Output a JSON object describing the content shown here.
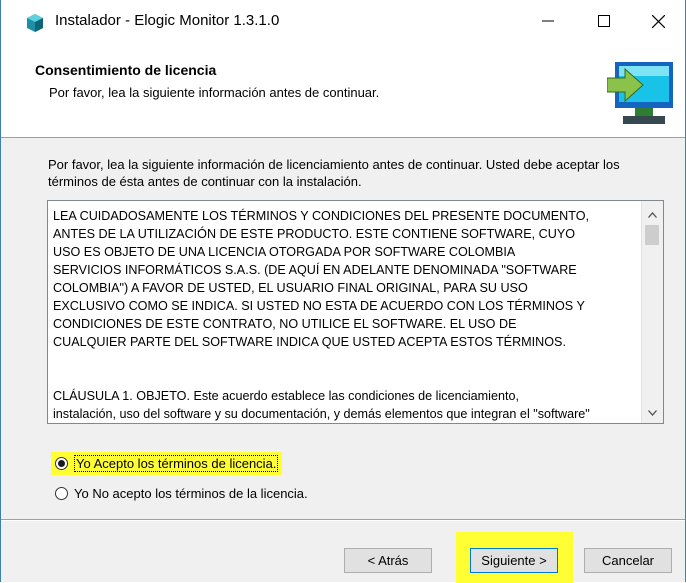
{
  "window": {
    "title": "Instalador - Elogic Monitor 1.3.1.0",
    "icon": "installer-app-icon",
    "minimize_glyph": "—",
    "maximize_glyph": "☐",
    "close_glyph": "✕"
  },
  "header": {
    "title": "Consentimiento de licencia",
    "subtitle": "Por favor, lea la siguiente información antes de continuar.",
    "image": "computer-install-icon"
  },
  "content": {
    "intro": "Por favor, lea la siguiente información de licenciamiento antes de continuar. Usted debe aceptar los términos de ésta antes de continuar con la instalación.",
    "license_text": "LEA CUIDADOSAMENTE LOS TÉRMINOS Y CONDICIONES DEL PRESENTE DOCUMENTO,\nANTES DE LA UTILIZACIÓN DE ESTE PRODUCTO. ESTE CONTIENE SOFTWARE, CUYO\nUSO ES OBJETO DE UNA LICENCIA OTORGADA POR SOFTWARE COLOMBIA\nSERVICIOS INFORMÁTICOS S.A.S. (DE AQUÍ EN ADELANTE DENOMINADA \"SOFTWARE\nCOLOMBIA\") A FAVOR DE USTED, EL USUARIO FINAL ORIGINAL, PARA SU USO\nEXCLUSIVO COMO SE INDICA. SI USTED NO ESTA DE ACUERDO CON LOS TÉRMINOS Y\nCONDICIONES DE ESTE CONTRATO, NO UTILICE EL SOFTWARE. EL USO DE\nCUALQUIER PARTE DEL SOFTWARE INDICA QUE USTED ACEPTA ESTOS TÉRMINOS.\n\n\nCLÁUSULA 1. OBJETO. Este acuerdo establece las condiciones de licenciamiento,\ninstalación, uso del software y su documentación, y demás elementos que integran el \"software\"",
    "radio_accept": "Yo Acepto los términos de licencia.",
    "radio_decline": "Yo No acepto los términos de la licencia.",
    "accept_selected": true
  },
  "buttons": {
    "back": "< Atrás",
    "next": "Siguiente >",
    "cancel": "Cancelar"
  },
  "colors": {
    "highlight": "#ffff33",
    "focus_border": "#0078d7"
  }
}
